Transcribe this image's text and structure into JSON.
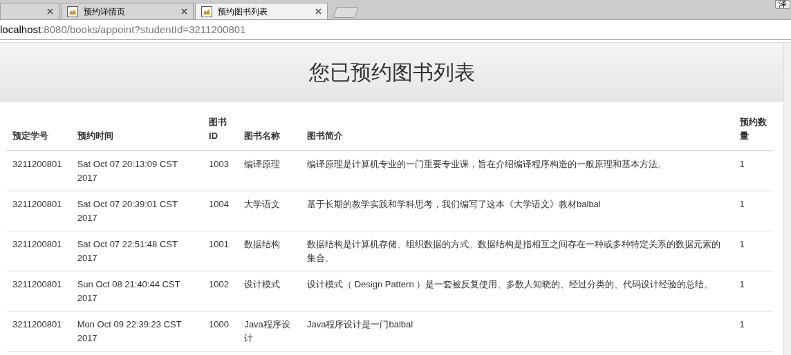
{
  "browser": {
    "tabs": [
      {
        "selected": false
      },
      {
        "title": "预约详情页",
        "selected": false
      },
      {
        "title": "预约图书列表",
        "selected": true
      }
    ],
    "ime_indicator": "泽",
    "address": {
      "host": "localhost",
      "path": ":8080/books/appoint?studentId=3211200801"
    }
  },
  "page": {
    "title": "您已预约图书列表",
    "table": {
      "columns": [
        "预定学号",
        "预约时间",
        "图书 ID",
        "图书名称",
        "图书简介",
        "预约数量"
      ],
      "rows": [
        [
          "3211200801",
          "Sat Oct 07 20:13:09 CST 2017",
          "1003",
          "编译原理",
          "编译原理是计算机专业的一门重要专业课，旨在介绍编译程序构造的一般原理和基本方法。",
          "1"
        ],
        [
          "3211200801",
          "Sat Oct 07 20:39:01 CST 2017",
          "1004",
          "大学语文",
          "基于长期的教学实践和学科思考，我们编写了这本《大学语文》教材balbal",
          "1"
        ],
        [
          "3211200801",
          "Sat Oct 07 22:51:48 CST 2017",
          "1001",
          "数据结构",
          "数据结构是计算机存储、组织数据的方式。数据结构是指相互之间存在一种或多种特定关系的数据元素的集合。",
          "1"
        ],
        [
          "3211200801",
          "Sun Oct 08 21:40:44 CST 2017",
          "1002",
          "设计模式",
          "设计模式（ Design Pattern ）是一套被反复使用、多数人知晓的、经过分类的、代码设计经验的总结。",
          "1"
        ],
        [
          "3211200801",
          "Mon Oct 09 22:39:23 CST 2017",
          "1000",
          "Java程序设计",
          "Java程序设计是一门balbal",
          "1"
        ]
      ]
    }
  }
}
